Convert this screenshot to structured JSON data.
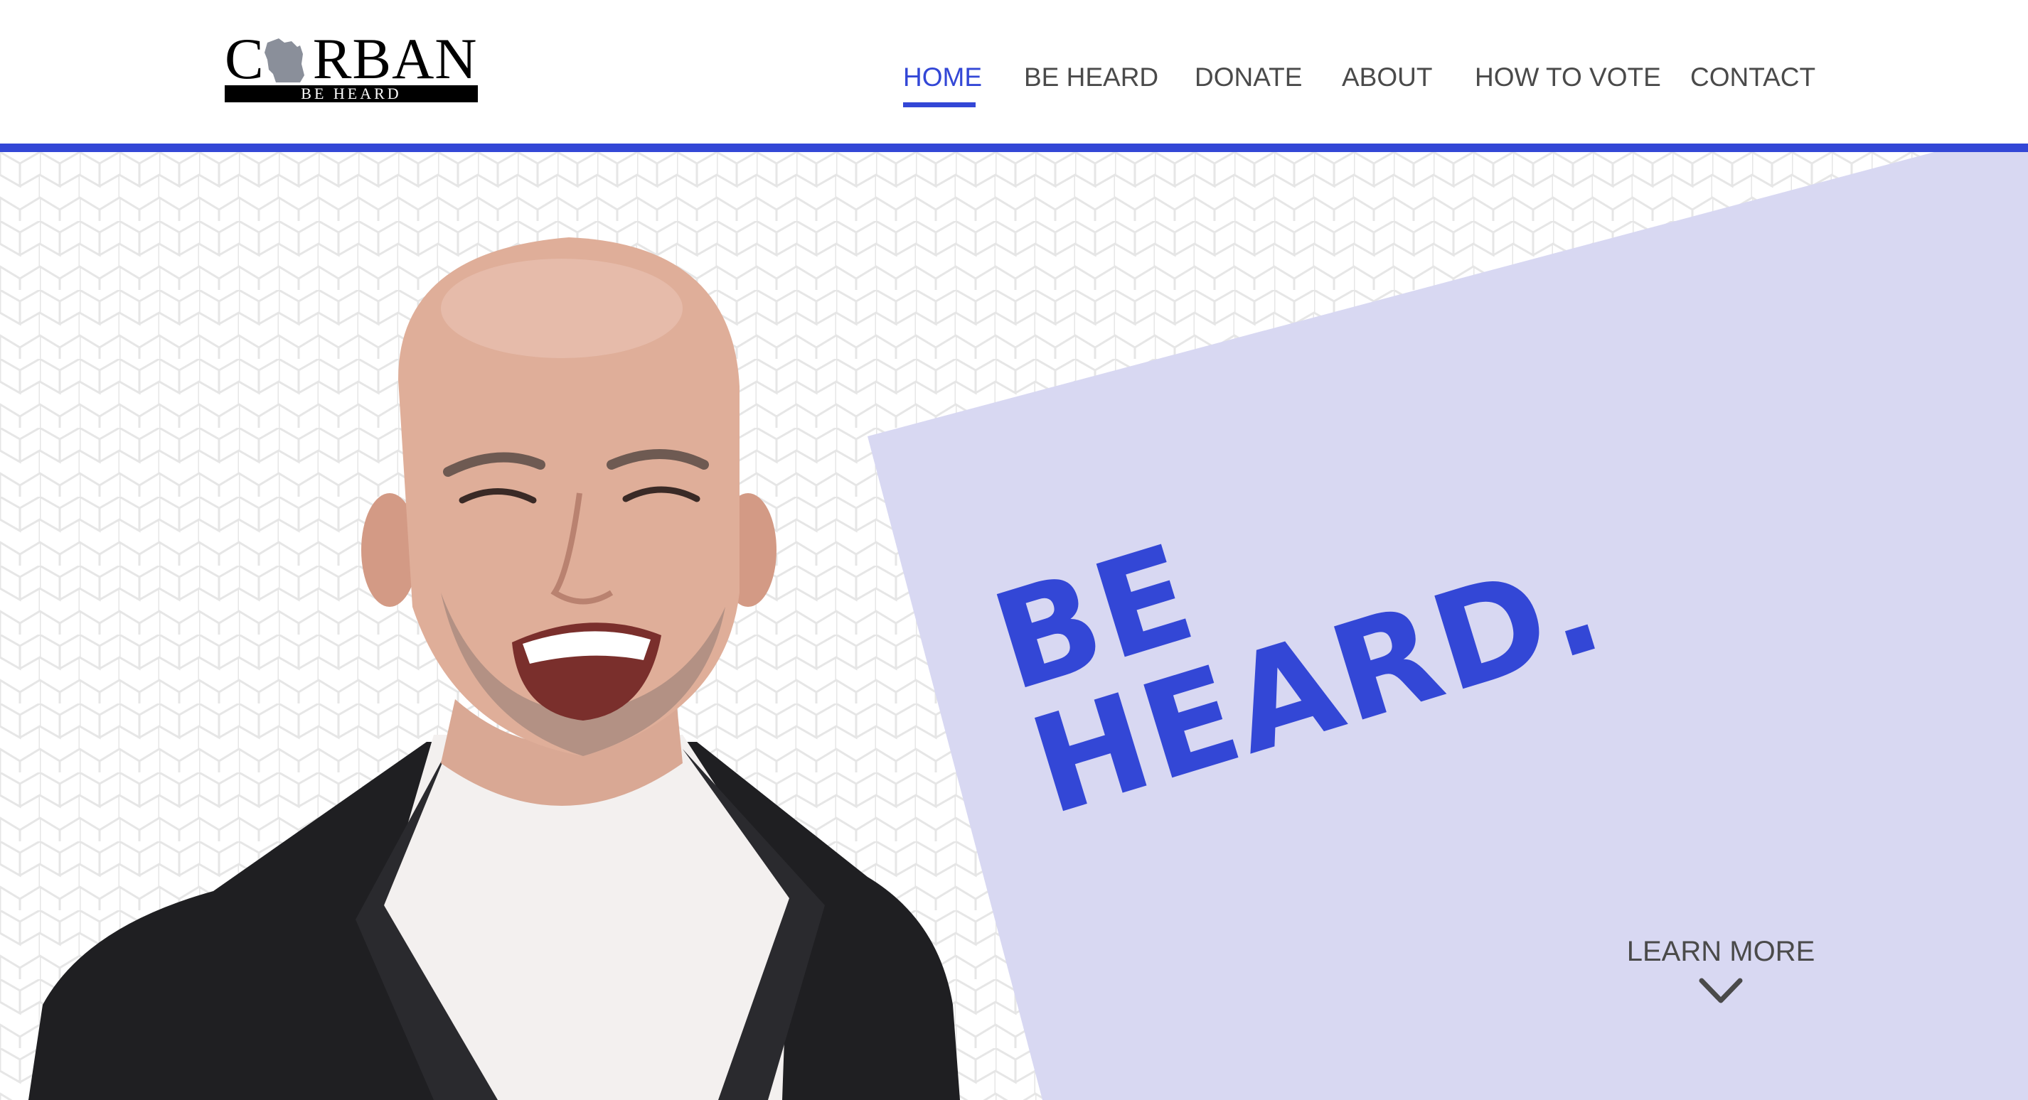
{
  "brand": {
    "name": "CORBAN",
    "tagline": "BE HEARD",
    "state_icon": "wisconsin-map-icon"
  },
  "nav": {
    "items": [
      {
        "label": "HOME",
        "active": true
      },
      {
        "label": "BE HEARD",
        "active": false
      },
      {
        "label": "DONATE",
        "active": false
      },
      {
        "label": "ABOUT",
        "active": false
      },
      {
        "label": "HOW TO VOTE",
        "active": false
      },
      {
        "label": "CONTACT",
        "active": false
      }
    ]
  },
  "hero": {
    "headline_line1": "BE",
    "headline_line2": "HEARD.",
    "learn_more_label": "LEARN MORE",
    "learn_more_icon": "chevron-down-icon",
    "photo_icon": "candidate-portrait"
  },
  "colors": {
    "accent": "#3347d6",
    "panel": "#d8d8f2",
    "nav_text": "#4a4a4a",
    "pattern": "#e6e6e6"
  }
}
